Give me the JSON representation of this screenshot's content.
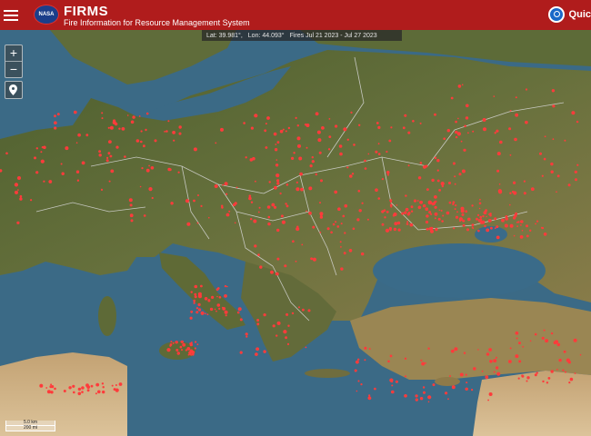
{
  "header": {
    "logo_text": "NASA",
    "title": "FIRMS",
    "subtitle": "Fire Information for Resource Management System",
    "quick_label": "Quic"
  },
  "infobar": {
    "lat": "Lat: 39.981°,",
    "lon": "Lon: 44.093°",
    "fires": "Fires Jul 21 2023 - Jul 27 2023"
  },
  "controls": {
    "zoom_in": "+",
    "zoom_out": "−"
  },
  "scale": {
    "km": "5.0 km",
    "mi": "200 mi"
  },
  "colors": {
    "header": "#b01c1c",
    "sea": "#3b6a86",
    "land": "#5b6a38",
    "desert": "#c9ad82",
    "fire": "#ff3b3b",
    "border": "#d8d8d8"
  },
  "icons": [
    "menu-icon",
    "nasa-logo",
    "search-icon",
    "location-pin-icon"
  ]
}
